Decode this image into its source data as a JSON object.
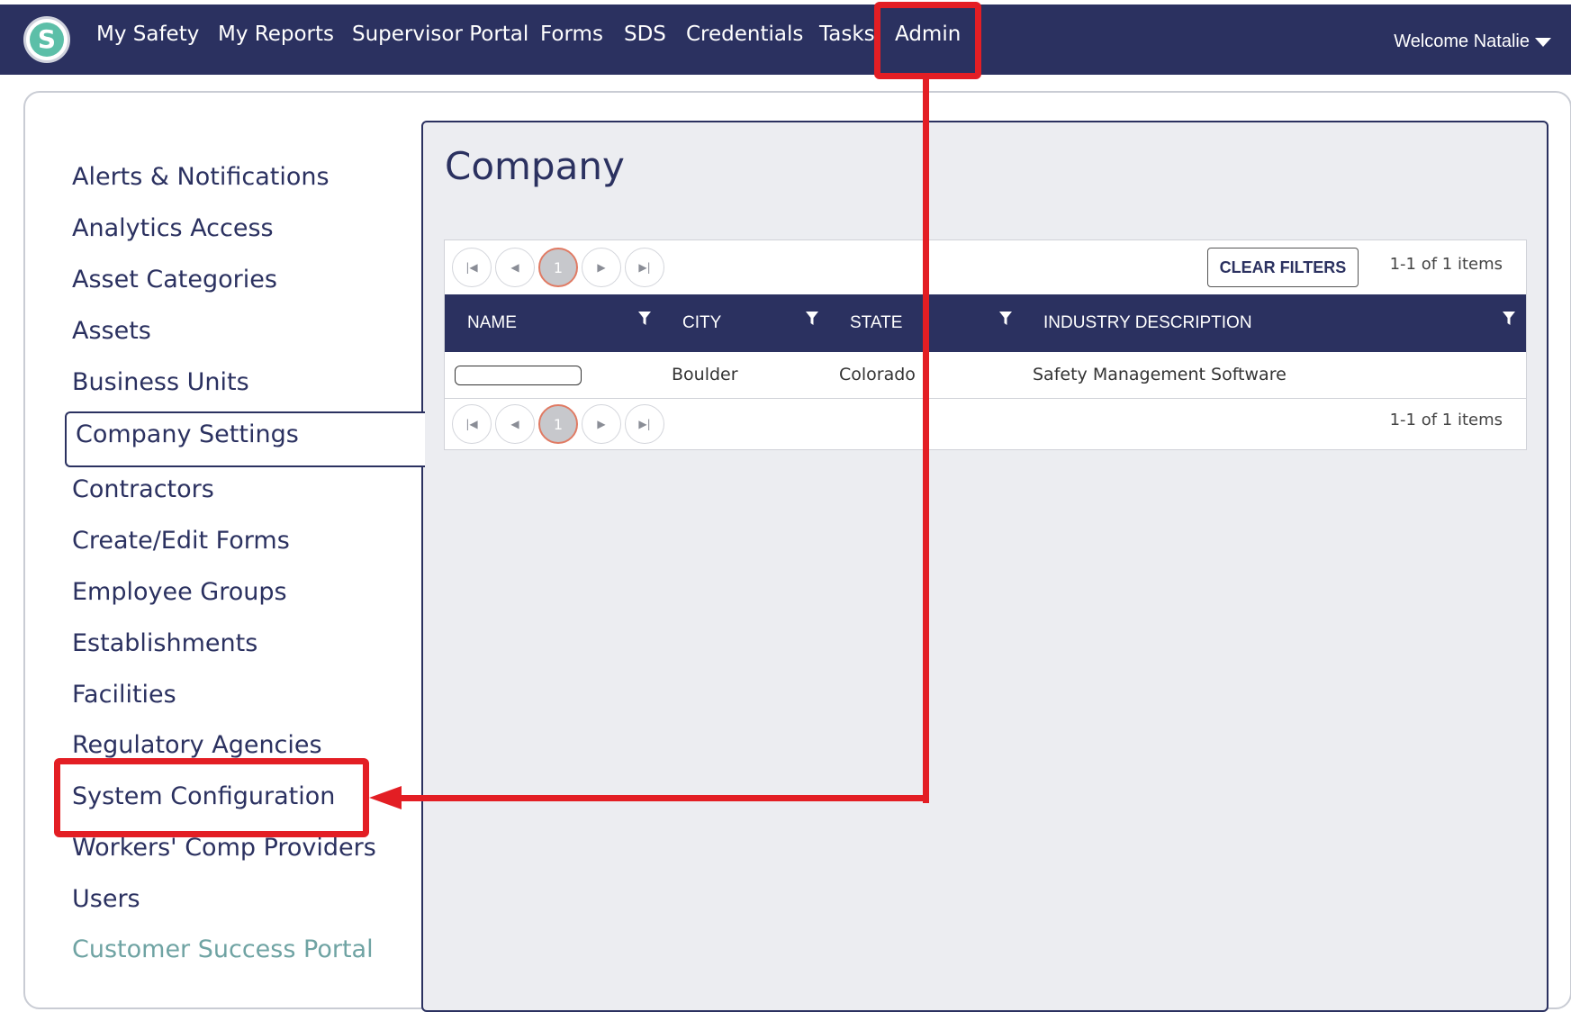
{
  "topnav": {
    "logo_letter": "S",
    "items": [
      "My Safety",
      "My Reports",
      "Supervisor Portal",
      "Forms",
      "SDS",
      "Credentials",
      "Tasks",
      "Admin"
    ],
    "welcome": "Welcome Natalie"
  },
  "sidebar": {
    "items": [
      "Alerts & Notifications",
      "Analytics Access",
      "Asset Categories",
      "Assets",
      "Business Units",
      "Company Settings",
      "Contractors",
      "Create/Edit Forms",
      "Employee Groups",
      "Establishments",
      "Facilities",
      "Regulatory Agencies",
      "System Configuration",
      "Workers' Comp Providers",
      "Users"
    ],
    "portal_link": "Customer Success Portal",
    "active": "Company Settings"
  },
  "main": {
    "title": "Company",
    "pager": {
      "current_page": "1",
      "items_label": "1-1 of 1 items"
    },
    "clear_filters": "CLEAR FILTERS",
    "columns": [
      "NAME",
      "CITY",
      "STATE",
      "INDUSTRY DESCRIPTION"
    ],
    "rows": [
      {
        "name": "",
        "city": "Boulder",
        "state": "Colorado",
        "industry": "Safety Management Software"
      }
    ]
  },
  "annotation_color": "#e31e24",
  "accent_color": "#2b3160"
}
